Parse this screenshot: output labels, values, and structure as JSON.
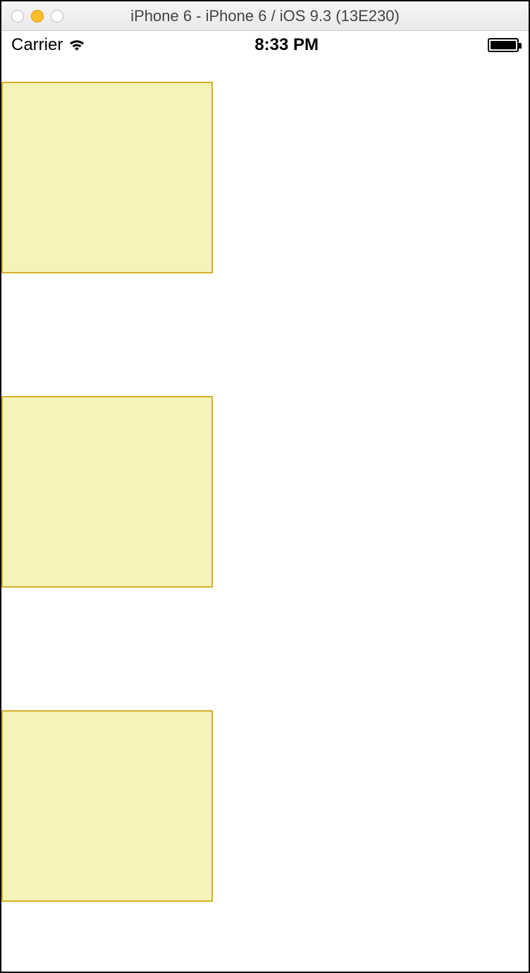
{
  "mac_titlebar": {
    "title": "iPhone 6 - iPhone 6 / iOS 9.3 (13E230)"
  },
  "status_bar": {
    "carrier": "Carrier",
    "time": "8:33 PM"
  },
  "boxes": {
    "fill_color": "#f6f3b8",
    "border_color": "#d2b02a"
  }
}
